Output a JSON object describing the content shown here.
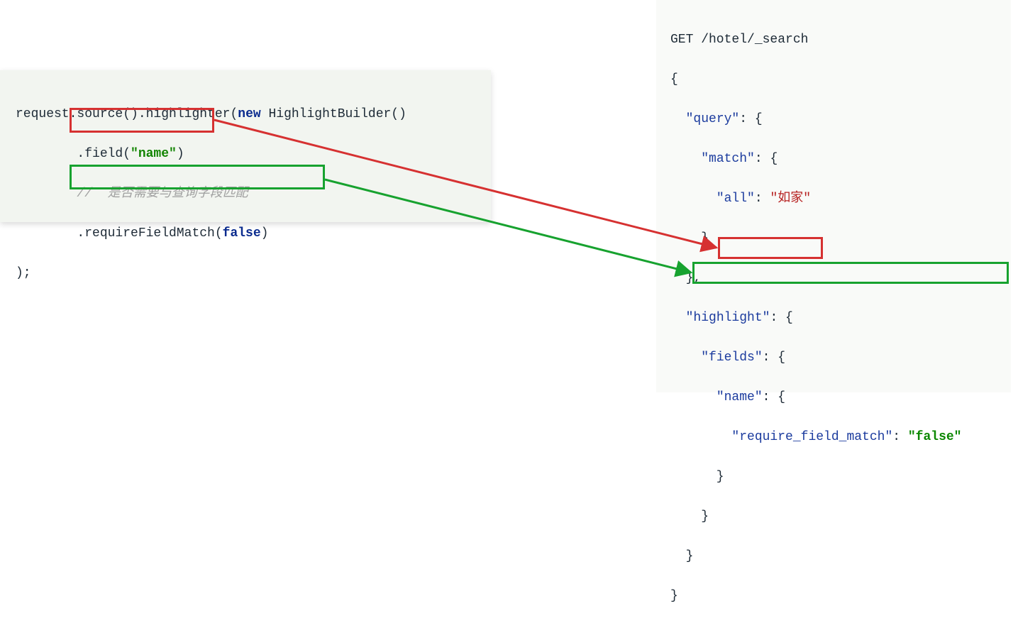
{
  "left": {
    "line1_a": "request.source().highlighter(",
    "line1_new": "new",
    "line1_b": " HighlightBuilder()",
    "line2_a": "        .field(",
    "line2_str": "\"name\"",
    "line2_b": ")",
    "line3_comment": "        //  是否需要与查询字段匹配",
    "line4_a": "        .requireFieldMatch(",
    "line4_false": "false",
    "line4_b": ")",
    "line5": ");"
  },
  "right": {
    "l1": "GET /hotel/_search",
    "l2": "{",
    "l3_ind": "  ",
    "l3_key": "\"query\"",
    "l3_end": ": {",
    "l4_ind": "    ",
    "l4_key": "\"match\"",
    "l4_end": ": {",
    "l5_ind": "      ",
    "l5_key": "\"all\"",
    "l5_mid": ": ",
    "l5_val": "\"如家\"",
    "l6": "    }",
    "l7": "  },",
    "l8_ind": "  ",
    "l8_key": "\"highlight\"",
    "l8_end": ": {",
    "l9_ind": "    ",
    "l9_key": "\"fields\"",
    "l9_end": ": {",
    "l10_ind": "      ",
    "l10_key": "\"name\"",
    "l10_end": ": {",
    "l11_ind": "        ",
    "l11_key": "\"require_field_match\"",
    "l11_mid": ": ",
    "l11_val": "\"false\"",
    "l12": "      }",
    "l13": "    }",
    "l14": "  }",
    "l15": "}"
  }
}
